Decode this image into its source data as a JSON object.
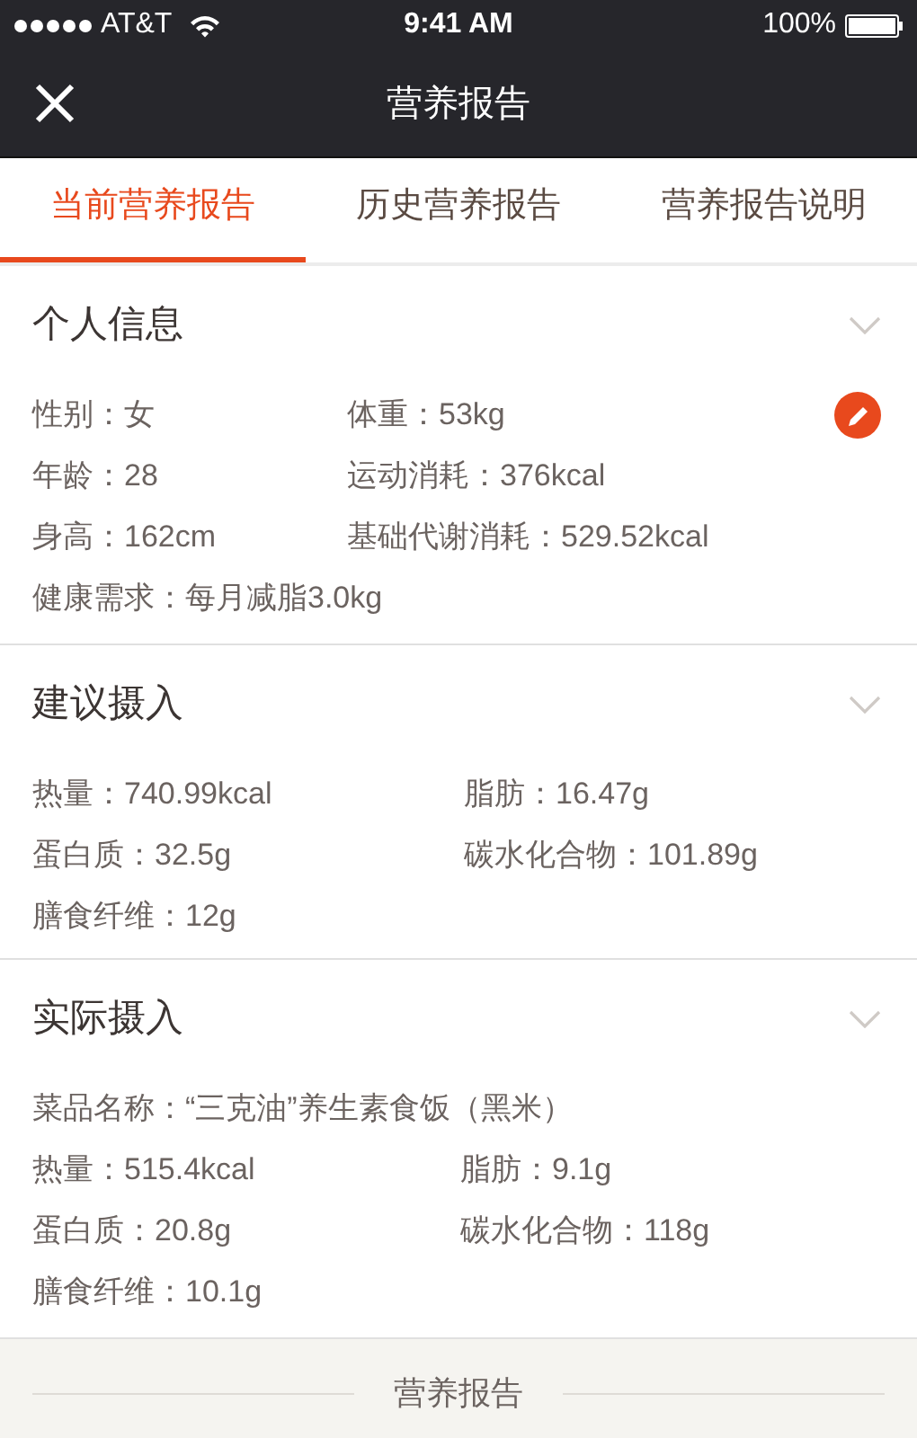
{
  "status_bar": {
    "carrier": "AT&T",
    "time": "9:41 AM",
    "battery": "100%"
  },
  "nav": {
    "title": "营养报告"
  },
  "tabs": [
    {
      "label": "当前营养报告",
      "selected": true
    },
    {
      "label": "历史营养报告",
      "selected": false
    },
    {
      "label": "营养报告说明",
      "selected": false
    }
  ],
  "sections": [
    {
      "title": "个人信息",
      "editable": true,
      "rows": [
        [
          "性别：女",
          "体重：53kg"
        ],
        [
          "年龄：28",
          "运动消耗：376kcal"
        ],
        [
          "身高：162cm",
          "基础代谢消耗：529.52kcal"
        ],
        [
          "健康需求：每月减脂3.0kg"
        ]
      ]
    },
    {
      "title": "建议摄入",
      "rows": [
        [
          "热量：740.99kcal",
          "脂肪：16.47g"
        ],
        [
          "蛋白质：32.5g",
          "碳水化合物：101.89g"
        ],
        [
          "膳食纤维：12g"
        ]
      ]
    },
    {
      "title": "实际摄入",
      "rows": [
        [
          "菜品名称：“三克油”养生素食饭（黑米）"
        ],
        [
          "热量：515.4kcal",
          "脂肪：9.1g"
        ],
        [
          "蛋白质：20.8g",
          "碳水化合物：118g"
        ],
        [
          "膳食纤维：10.1g"
        ]
      ]
    }
  ],
  "footer": {
    "label": "营养报告"
  }
}
